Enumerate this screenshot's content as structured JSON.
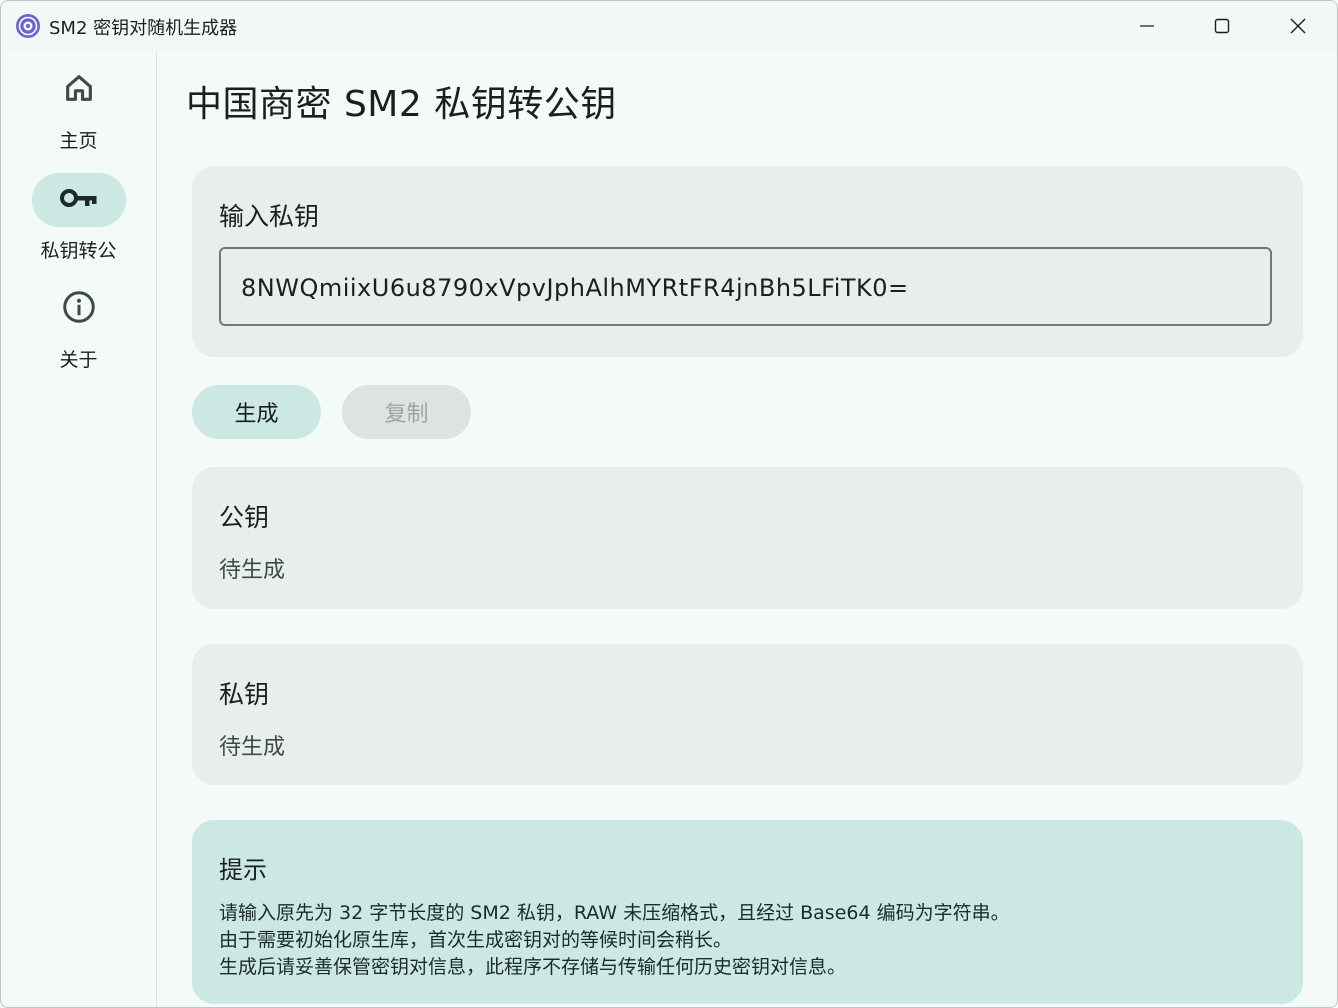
{
  "window": {
    "title": "SM2 密钥对随机生成器",
    "minimize_icon": "minimize-icon",
    "maximize_icon": "maximize-icon",
    "close_icon": "close-icon"
  },
  "sidebar": {
    "items": [
      {
        "label": "主页",
        "icon": "home-icon",
        "active": false
      },
      {
        "label": "私钥转公",
        "icon": "key-icon",
        "active": true
      },
      {
        "label": "关于",
        "icon": "info-icon",
        "active": false
      }
    ]
  },
  "main": {
    "title": "中国商密 SM2 私钥转公钥",
    "input_card": {
      "title": "输入私钥",
      "value": "8NWQmiixU6u8790xVpvJphAlhMYRtFR4jnBh5LFiTK0="
    },
    "buttons": {
      "generate": "生成",
      "copy": "复制"
    },
    "public_key": {
      "title": "公钥",
      "value": "待生成"
    },
    "private_key": {
      "title": "私钥",
      "value": "待生成"
    },
    "tips": {
      "title": "提示",
      "lines": [
        "请输入原先为 32 字节长度的 SM2 私钥，RAW 未压缩格式，且经过 Base64 编码为字符串。",
        "由于需要初始化原生库，首次生成密钥对的等候时间会稍长。",
        "生成后请妥善保管密钥对信息，此程序不存储与传输任何历史密钥对信息。"
      ]
    }
  },
  "colors": {
    "accent": "#cce8e2",
    "surface": "#e8eeeb",
    "background": "#f3faf7",
    "disabled": "#dde3e0"
  }
}
